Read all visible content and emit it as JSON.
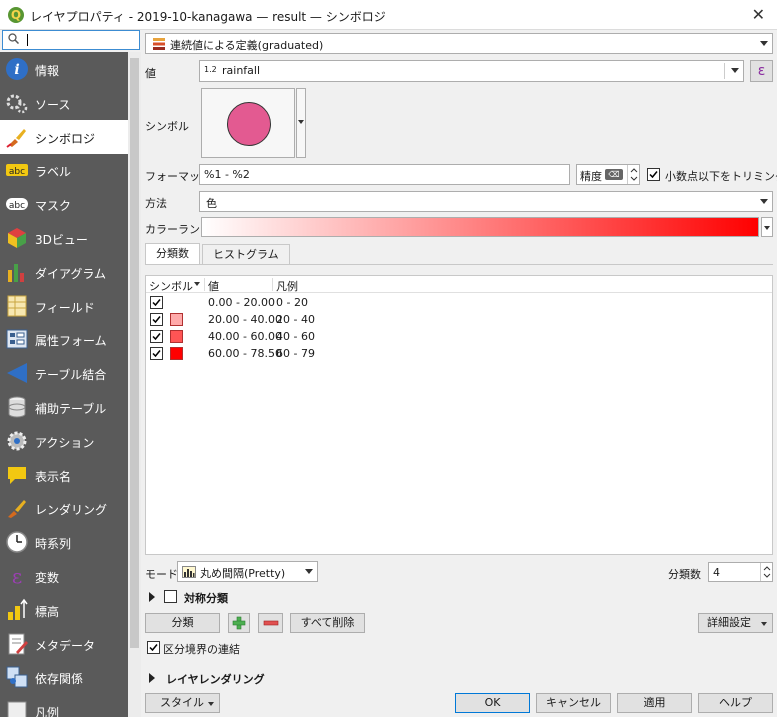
{
  "window": {
    "title": "レイヤプロパティ - 2019-10-kanagawa — result — シンボロジ",
    "app_icon": "Q",
    "close_glyph": "✕"
  },
  "sidebar": {
    "search_icon": "🔍",
    "items": [
      {
        "label": "情報",
        "icon": "info-icon",
        "active": false
      },
      {
        "label": "ソース",
        "icon": "source-icon",
        "active": false
      },
      {
        "label": "シンボロジ",
        "icon": "paintbrush-icon",
        "active": true
      },
      {
        "label": "ラベル",
        "icon": "label-abc-icon",
        "active": false
      },
      {
        "label": "マスク",
        "icon": "mask-abc-icon",
        "active": false
      },
      {
        "label": "3Dビュー",
        "icon": "cube-3d-icon",
        "active": false
      },
      {
        "label": "ダイアグラム",
        "icon": "diagram-icon",
        "active": false
      },
      {
        "label": "フィールド",
        "icon": "fields-icon",
        "active": false
      },
      {
        "label": "属性フォーム",
        "icon": "attribute-form-icon",
        "active": false
      },
      {
        "label": "テーブル結合",
        "icon": "join-icon",
        "active": false
      },
      {
        "label": "補助テーブル",
        "icon": "auxiliary-table-icon",
        "active": false
      },
      {
        "label": "アクション",
        "icon": "action-gear-icon",
        "active": false
      },
      {
        "label": "表示名",
        "icon": "display-name-icon",
        "active": false
      },
      {
        "label": "レンダリング",
        "icon": "rendering-brush-icon",
        "active": false
      },
      {
        "label": "時系列",
        "icon": "clock-icon",
        "active": false
      },
      {
        "label": "変数",
        "icon": "variable-epsilon-icon",
        "active": false
      },
      {
        "label": "標高",
        "icon": "elevation-icon",
        "active": false
      },
      {
        "label": "メタデータ",
        "icon": "metadata-icon",
        "active": false
      },
      {
        "label": "依存関係",
        "icon": "dependencies-icon",
        "active": false
      },
      {
        "label": "凡例",
        "icon": "legend-icon",
        "active": false
      }
    ]
  },
  "renderer": {
    "type_label": "連続値による定義(graduated)"
  },
  "value_row": {
    "label": "値",
    "field_type": "1.2",
    "field_name": "rainfall",
    "expression_button": "ε"
  },
  "symbol_row": {
    "label": "シンボル",
    "color": "#e35a91"
  },
  "format_row": {
    "label": "フォーマット",
    "value": "%1 - %2",
    "precision_label": "精度",
    "precision_clear": "⌫",
    "trim_checked": true,
    "trim_label": "小数点以下をトリミング"
  },
  "method_row": {
    "label": "方法",
    "value": "色"
  },
  "color_ramp_row": {
    "label": "カラーランプ",
    "start_color": "#ffffff",
    "end_color": "#ff0000"
  },
  "tabs": [
    {
      "label": "分類数",
      "active": true
    },
    {
      "label": "ヒストグラム",
      "active": false
    }
  ],
  "class_table": {
    "headers": [
      "シンボル",
      "値",
      "凡例"
    ],
    "rows": [
      {
        "checked": true,
        "color": "#ffffff",
        "value": "0.00 - 20.00",
        "legend": "0 - 20"
      },
      {
        "checked": true,
        "color": "#ffaaaa",
        "value": "20.00 - 40.00",
        "legend": "20 - 40"
      },
      {
        "checked": true,
        "color": "#ff5555",
        "value": "40.00 - 60.00",
        "legend": "40 - 60"
      },
      {
        "checked": true,
        "color": "#ff0000",
        "value": "60.00 - 78.50",
        "legend": "60 - 79"
      }
    ]
  },
  "mode_row": {
    "label": "モード",
    "value": "丸め間隔(Pretty)",
    "classes_label": "分類数",
    "classes_value": "4"
  },
  "symmetric": {
    "label": "対称分類",
    "checked": false
  },
  "actions": {
    "classify": "分類",
    "add_icon": "+",
    "remove_icon": "−",
    "delete_all": "すべて削除",
    "advanced": "詳細設定"
  },
  "link_boundaries": {
    "checked": true,
    "label": "区分境界の連結"
  },
  "layer_rendering": {
    "label": "レイヤレンダリング"
  },
  "footer": {
    "style": "スタイル",
    "ok": "OK",
    "cancel": "キャンセル",
    "apply": "適用",
    "help": "ヘルプ"
  }
}
